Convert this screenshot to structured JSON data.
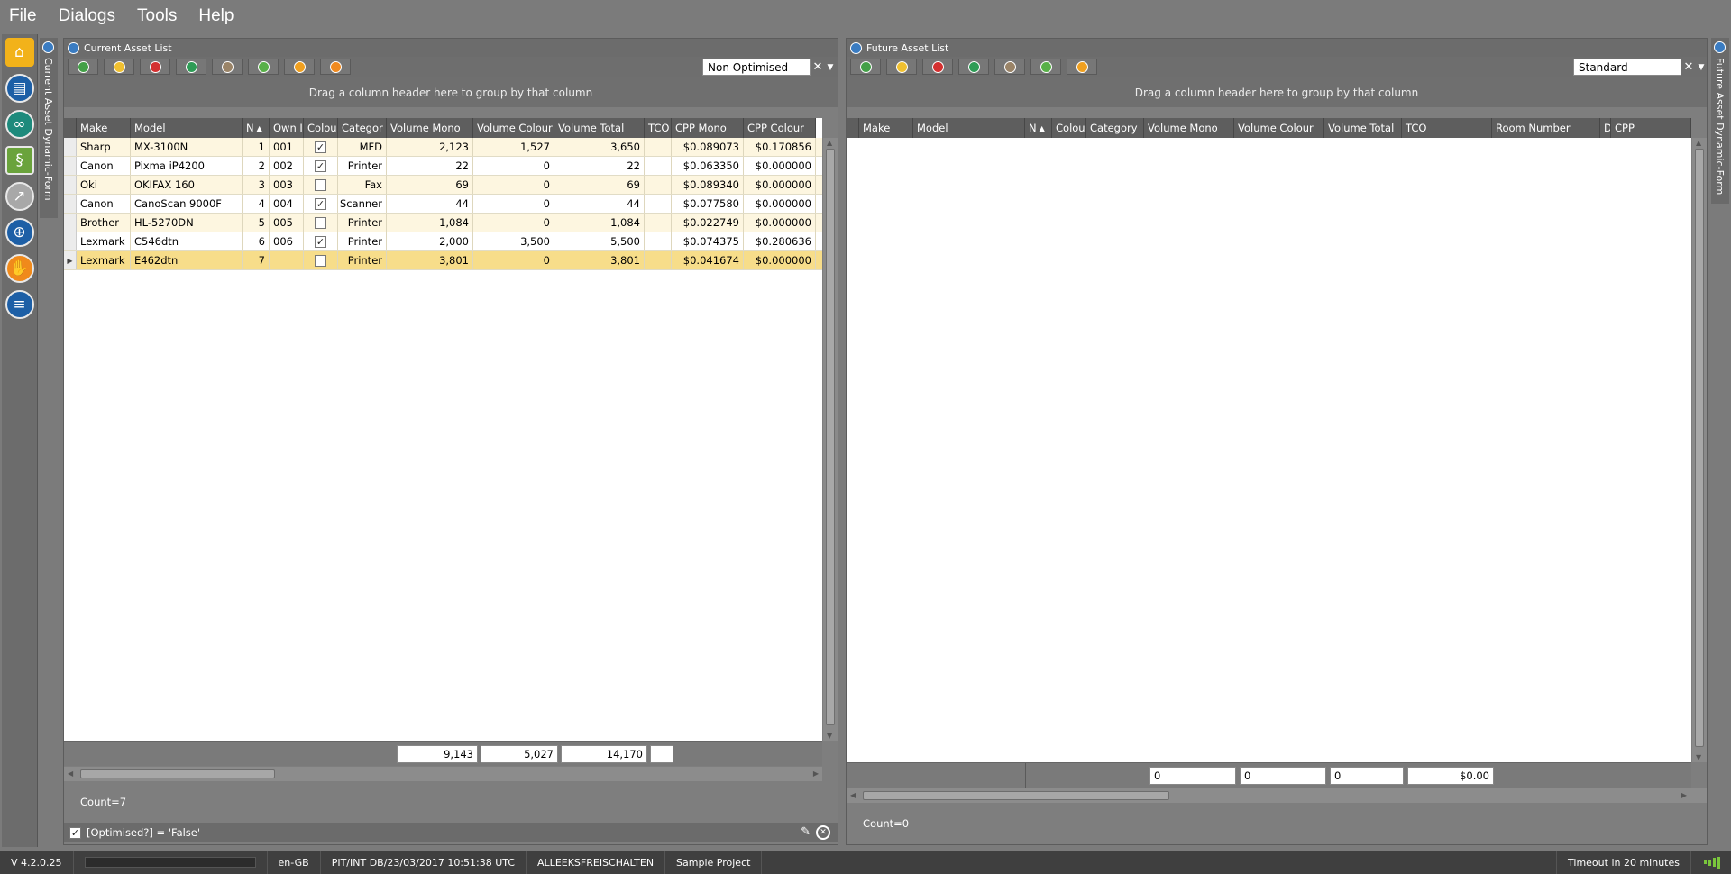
{
  "menu": [
    "File",
    "Dialogs",
    "Tools",
    "Help"
  ],
  "side_tab_label": "Current Asset Dynamic-Form",
  "right_side_tab_label": "Future Asset Dynamic-Form",
  "current": {
    "title": "Current Asset List",
    "filter_combo": "Non Optimised",
    "group_hint": "Drag a column header here to group by that column",
    "columns": [
      "Make",
      "Model",
      "N",
      "Own Il",
      "Colou",
      "Categor",
      "Volume Mono",
      "Volume Colour",
      "Volume Total",
      "TCO",
      "CPP Mono",
      "CPP Colour"
    ],
    "rows": [
      {
        "make": "Sharp",
        "model": "MX-3100N",
        "n": "1",
        "own": "001",
        "colour": true,
        "category": "MFD",
        "vmono": "2,123",
        "vcolour": "1,527",
        "vtotal": "3,650",
        "tco": "",
        "cppmono": "$0.089073",
        "cppcolour": "$0.170856"
      },
      {
        "make": "Canon",
        "model": "Pixma iP4200",
        "n": "2",
        "own": "002",
        "colour": true,
        "category": "Printer",
        "vmono": "22",
        "vcolour": "0",
        "vtotal": "22",
        "tco": "",
        "cppmono": "$0.063350",
        "cppcolour": "$0.000000"
      },
      {
        "make": "Oki",
        "model": "OKIFAX 160",
        "n": "3",
        "own": "003",
        "colour": false,
        "category": "Fax",
        "vmono": "69",
        "vcolour": "0",
        "vtotal": "69",
        "tco": "",
        "cppmono": "$0.089340",
        "cppcolour": "$0.000000"
      },
      {
        "make": "Canon",
        "model": "CanoScan 9000F",
        "n": "4",
        "own": "004",
        "colour": true,
        "category": "Scanner",
        "vmono": "44",
        "vcolour": "0",
        "vtotal": "44",
        "tco": "",
        "cppmono": "$0.077580",
        "cppcolour": "$0.000000"
      },
      {
        "make": "Brother",
        "model": "HL-5270DN",
        "n": "5",
        "own": "005",
        "colour": false,
        "category": "Printer",
        "vmono": "1,084",
        "vcolour": "0",
        "vtotal": "1,084",
        "tco": "",
        "cppmono": "$0.022749",
        "cppcolour": "$0.000000"
      },
      {
        "make": "Lexmark",
        "model": "C546dtn",
        "n": "6",
        "own": "006",
        "colour": true,
        "category": "Printer",
        "vmono": "2,000",
        "vcolour": "3,500",
        "vtotal": "5,500",
        "tco": "",
        "cppmono": "$0.074375",
        "cppcolour": "$0.280636"
      },
      {
        "make": "Lexmark",
        "model": "E462dtn",
        "n": "7",
        "own": "",
        "colour": false,
        "category": "Printer",
        "vmono": "3,801",
        "vcolour": "0",
        "vtotal": "3,801",
        "tco": "",
        "cppmono": "$0.041674",
        "cppcolour": "$0.000000"
      }
    ],
    "totals": {
      "vmono": "9,143",
      "vcolour": "5,027",
      "vtotal": "14,170",
      "tco": ""
    },
    "count": "Count=7",
    "filter_expr": "[Optimised?] = 'False'"
  },
  "future": {
    "title": "Future Asset List",
    "filter_combo": "Standard",
    "group_hint": "Drag a column header here to group by that column",
    "columns": [
      "Make",
      "Model",
      "N",
      "Colou",
      "Category",
      "Volume Mono",
      "Volume Colour",
      "Volume Total",
      "TCO",
      "Room Number",
      "D",
      "CPP"
    ],
    "totals": {
      "vmono": "0",
      "vcolour": "0",
      "vtotal": "0",
      "tco": "$0.00"
    },
    "count": "Count=0"
  },
  "status": {
    "version": "V 4.2.0.25",
    "locale": "en-GB",
    "db": "PIT/INT DB/23/03/2017 10:51:38 UTC",
    "user": "ALLEEKSFREISCHALTEN",
    "project": "Sample Project",
    "timeout": "Timeout in 20 minutes"
  },
  "icons": {
    "add": "plus-circle-icon",
    "refresh": "refresh-icon",
    "delete": "minus-circle-icon",
    "link": "link-icon",
    "star": "star-icon",
    "check": "check-icon",
    "sync": "sync-icon"
  }
}
